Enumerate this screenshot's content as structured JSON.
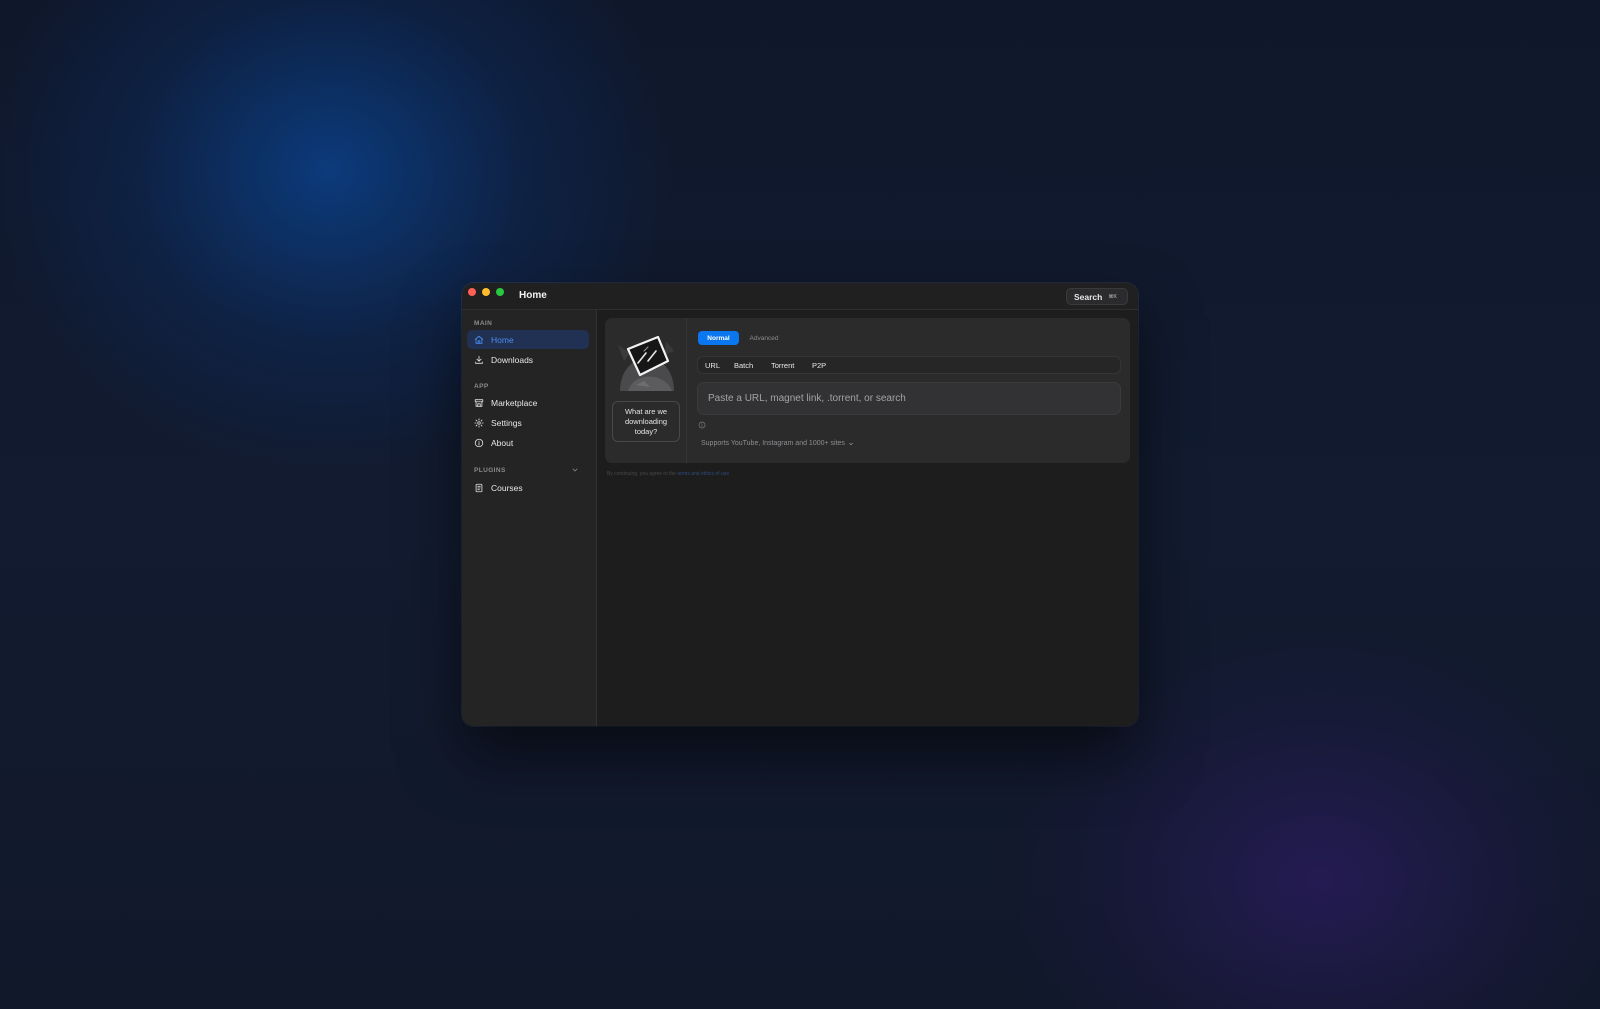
{
  "window": {
    "title": "Home"
  },
  "header": {
    "search_label": "Search",
    "search_shortcut": "⌘K"
  },
  "sidebar": {
    "sections": [
      {
        "label": "MAIN",
        "items": [
          {
            "label": "Home",
            "icon": "home-icon",
            "active": true
          },
          {
            "label": "Downloads",
            "icon": "download-icon",
            "active": false
          }
        ]
      },
      {
        "label": "APP",
        "items": [
          {
            "label": "Marketplace",
            "icon": "store-icon",
            "active": false
          },
          {
            "label": "Settings",
            "icon": "gear-icon",
            "active": false
          },
          {
            "label": "About",
            "icon": "info-icon",
            "active": false
          }
        ]
      },
      {
        "label": "PLUGINS",
        "collapsible": true,
        "items": [
          {
            "label": "Courses",
            "icon": "book-icon",
            "active": false
          }
        ]
      }
    ]
  },
  "main": {
    "mascot_bubble": "What are we downloading today?",
    "modes": [
      "Normal",
      "Advanced"
    ],
    "active_mode": "Normal",
    "tabs": [
      "URL",
      "Batch",
      "Torrent",
      "P2P"
    ],
    "input_placeholder": "Paste a URL, magnet link, .torrent, or search",
    "supports_text": "Supports YouTube, Instagram and 1000+ sites",
    "footer_text": "By continuing, you agree to the",
    "footer_link": "terms and ethics of use"
  },
  "colors": {
    "accent": "#0a76f0",
    "active_nav_bg": "#213153",
    "active_nav_text": "#4a8cf0",
    "window_bg": "#1d1d1e",
    "sidebar_bg": "#242425"
  }
}
